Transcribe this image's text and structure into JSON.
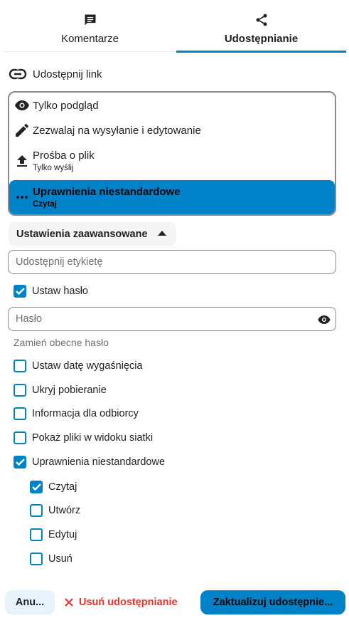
{
  "tabs": {
    "comments": {
      "label": "Komentarze",
      "icon": "comment-icon"
    },
    "sharing": {
      "label": "Udostępnianie",
      "icon": "share-icon",
      "active": true
    }
  },
  "share_link": {
    "label": "Udostępnij link",
    "icon": "link-icon"
  },
  "permissions": [
    {
      "title": "Tylko podgląd",
      "subtitle": "",
      "icon": "eye-icon",
      "selected": false
    },
    {
      "title": "Zezwalaj na wysyłanie i edytowanie",
      "subtitle": "",
      "icon": "pencil-icon",
      "selected": false
    },
    {
      "title": "Prośba o plik",
      "subtitle": "Tylko wyślij",
      "icon": "upload-icon",
      "selected": false
    },
    {
      "title": "Uprawnienia niestandardowe",
      "subtitle": "Czytaj",
      "icon": "dots-icon",
      "selected": true
    }
  ],
  "advanced": {
    "label": "Ustawienia zaawansowane",
    "expanded": true
  },
  "share_label_input": {
    "placeholder": "Udostępnij etykietę",
    "value": ""
  },
  "set_password": {
    "label": "Ustaw hasło",
    "checked": true
  },
  "password_input": {
    "placeholder": "Hasło",
    "value": ""
  },
  "password_hint": "Zamień obecne hasło",
  "options": [
    {
      "label": "Ustaw datę wygaśnięcia",
      "checked": false
    },
    {
      "label": "Ukryj pobieranie",
      "checked": false
    },
    {
      "label": "Informacja dla odbiorcy",
      "checked": false
    },
    {
      "label": "Pokaż pliki w widoku siatki",
      "checked": false
    },
    {
      "label": "Uprawnienia niestandardowe",
      "checked": true
    }
  ],
  "custom_permissions": [
    {
      "label": "Czytaj",
      "checked": true
    },
    {
      "label": "Utwórz",
      "checked": false
    },
    {
      "label": "Edytuj",
      "checked": false
    },
    {
      "label": "Usuń",
      "checked": false
    }
  ],
  "footer": {
    "cancel_label": "Anu...",
    "delete_label": "Usuń udostępnianie",
    "update_label": "Zaktualizuj udostępnie..."
  },
  "colors": {
    "accent": "#0082c9",
    "danger": "#e9322d",
    "text": "#222222",
    "muted": "#707070"
  }
}
